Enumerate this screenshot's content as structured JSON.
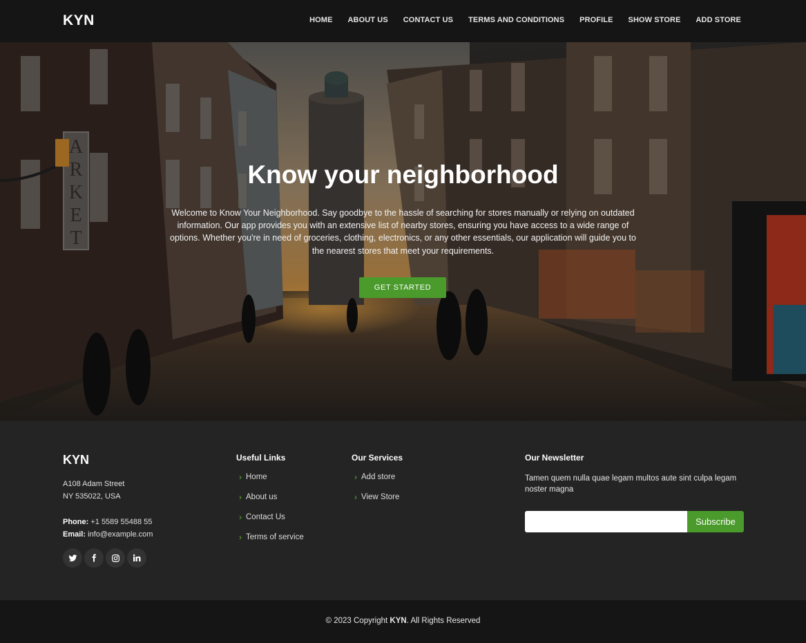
{
  "header": {
    "logo": "KYN",
    "nav": [
      "HOME",
      "ABOUT US",
      "CONTACT US",
      "TERMS AND CONDITIONS",
      "PROFILE",
      "SHOW STORE",
      "ADD STORE"
    ]
  },
  "hero": {
    "title": "Know your neighborhood",
    "description": "Welcome to Know Your Neighborhood. Say goodbye to the hassle of searching for stores manually or relying on outdated information. Our app provides you with an extensive list of nearby stores, ensuring you have access to a wide range of options. Whether you're in need of groceries, clothing, electronics, or any other essentials, our application will guide you to the nearest stores that meet your requirements.",
    "cta_label": "GET STARTED",
    "sign_text": "ARKET"
  },
  "footer": {
    "logo": "KYN",
    "address_line1": "A108 Adam Street",
    "address_line2": "NY 535022, USA",
    "phone_label": "Phone:",
    "phone": "+1 5589 55488 55",
    "email_label": "Email:",
    "email": "info@example.com",
    "socials": [
      "twitter-icon",
      "facebook-icon",
      "instagram-icon",
      "linkedin-icon"
    ],
    "useful_links": {
      "title": "Useful Links",
      "items": [
        "Home",
        "About us",
        "Contact Us",
        "Terms of service"
      ]
    },
    "services": {
      "title": "Our Services",
      "items": [
        "Add store",
        "View Store"
      ]
    },
    "newsletter": {
      "title": "Our Newsletter",
      "text": "Tamen quem nulla quae legam multos aute sint culpa legam noster magna",
      "input_value": "",
      "button_label": "Subscribe"
    },
    "copyright_prefix": "© 2023 Copyright",
    "copyright_brand": "KYN",
    "copyright_suffix": ". All Rights Reserved"
  },
  "colors": {
    "accent": "#4a9a2c",
    "header_bg": "#151515",
    "footer_bg": "#242424"
  }
}
